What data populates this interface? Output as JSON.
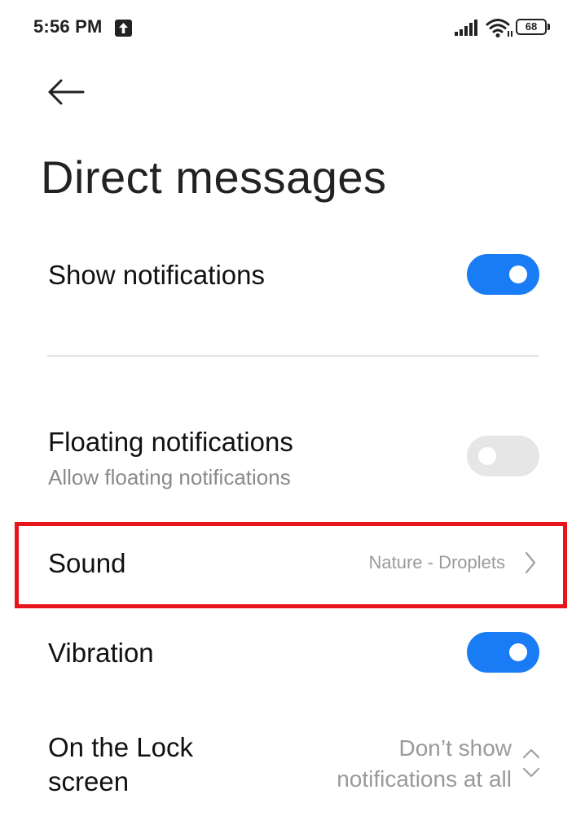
{
  "status_bar": {
    "time": "5:56 PM",
    "battery_level": "68",
    "icons": [
      "upload-icon",
      "signal-icon",
      "wifi-icon",
      "battery-icon"
    ]
  },
  "header": {
    "back_icon": "arrow-left-icon",
    "title": "Direct messages"
  },
  "settings": {
    "show_notifications": {
      "label": "Show notifications",
      "enabled": true
    },
    "floating_notifications": {
      "label": "Floating notifications",
      "sublabel": "Allow floating notifications",
      "enabled": false
    },
    "sound": {
      "label": "Sound",
      "value": "Nature - Droplets"
    },
    "vibration": {
      "label": "Vibration",
      "enabled": true
    },
    "lock_screen": {
      "label_line1": "On the Lock",
      "label_line2": "screen",
      "value_line1": "Don’t show",
      "value_line2": "notifications at all"
    }
  },
  "colors": {
    "accent": "#1a7cf5",
    "highlight": "#e8141b",
    "toggle_off": "#e6e6e6",
    "secondary_text": "#8a8a8a"
  }
}
